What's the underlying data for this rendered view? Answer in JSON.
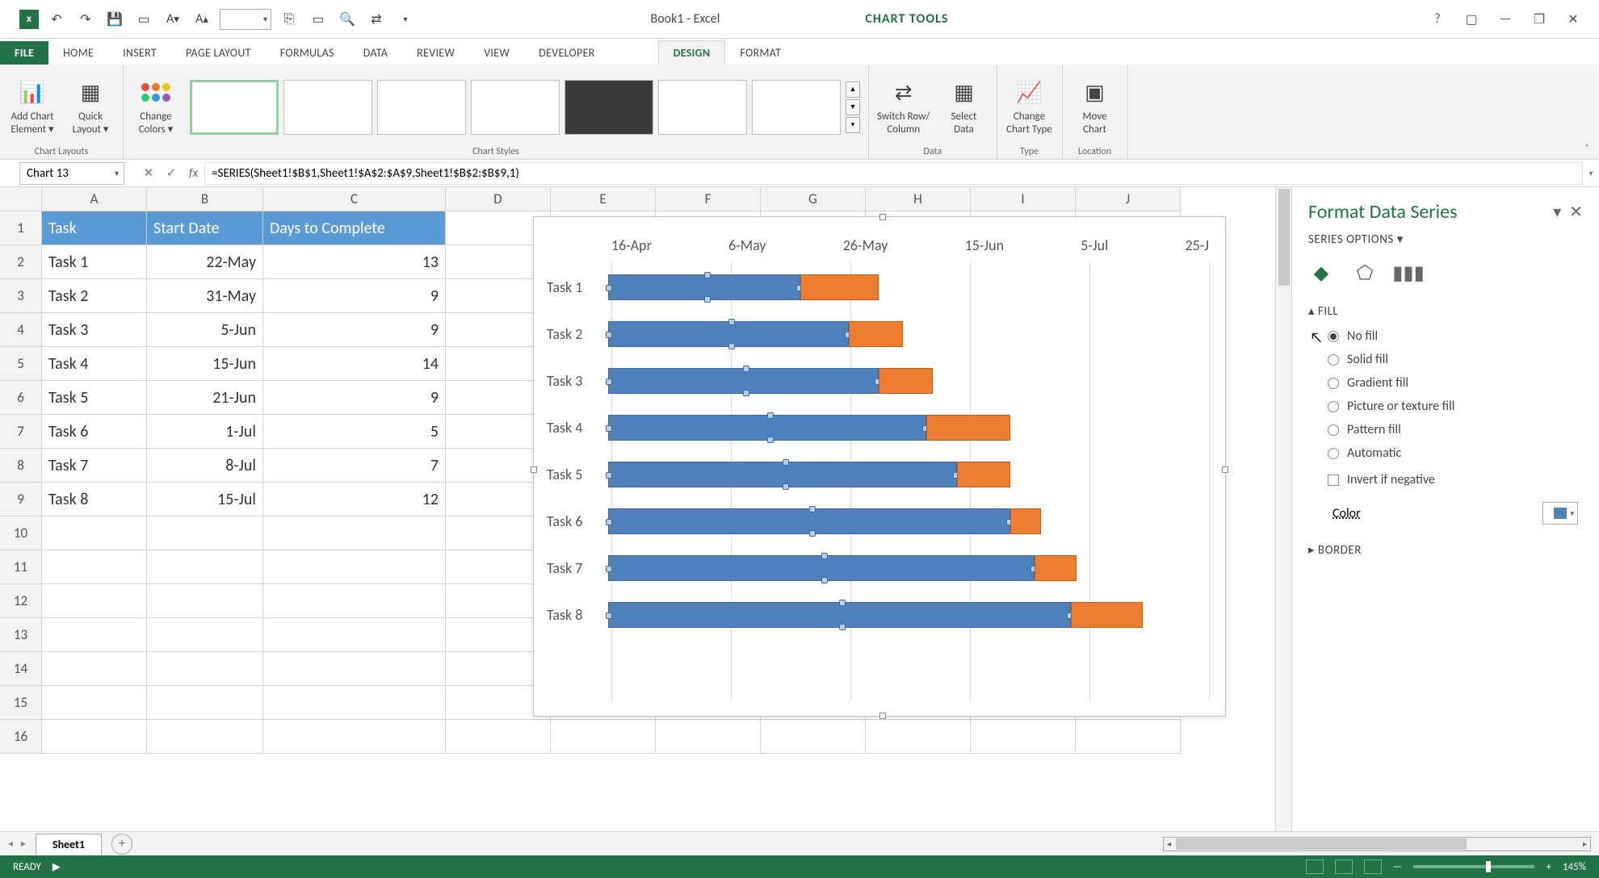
{
  "titlebar": {
    "app_title": "Book1 - Excel",
    "context_tools": "CHART TOOLS"
  },
  "ribbon": {
    "tabs": [
      "FILE",
      "HOME",
      "INSERT",
      "PAGE LAYOUT",
      "FORMULAS",
      "DATA",
      "REVIEW",
      "VIEW",
      "DEVELOPER"
    ],
    "context_tabs": [
      "DESIGN",
      "FORMAT"
    ],
    "active_tab": "DESIGN",
    "groups": {
      "chart_layouts": {
        "label": "Chart Layouts",
        "add_element": "Add Chart\nElement ▾",
        "quick_layout": "Quick\nLayout ▾"
      },
      "chart_styles": {
        "label": "Chart Styles",
        "change_colors": "Change\nColors ▾"
      },
      "data": {
        "label": "Data",
        "switch": "Switch Row/\nColumn",
        "select": "Select\nData"
      },
      "type": {
        "label": "Type",
        "change_type": "Change\nChart Type"
      },
      "location": {
        "label": "Location",
        "move": "Move\nChart"
      }
    }
  },
  "formula_bar": {
    "name_box": "Chart 13",
    "formula": "=SERIES(Sheet1!$B$1,Sheet1!$A$2:$A$9,Sheet1!$B$2:$B$9,1)"
  },
  "sheet": {
    "columns": [
      "A",
      "B",
      "C",
      "D",
      "E",
      "F",
      "G",
      "H",
      "I",
      "J"
    ],
    "headers": {
      "A": "Task",
      "B": "Start Date",
      "C": "Days to Complete"
    },
    "rows": [
      {
        "task": "Task 1",
        "start": "22-May",
        "days": "13"
      },
      {
        "task": "Task 2",
        "start": "31-May",
        "days": "9"
      },
      {
        "task": "Task 3",
        "start": "5-Jun",
        "days": "9"
      },
      {
        "task": "Task 4",
        "start": "15-Jun",
        "days": "14"
      },
      {
        "task": "Task 5",
        "start": "21-Jun",
        "days": "9"
      },
      {
        "task": "Task 6",
        "start": "1-Jul",
        "days": "5"
      },
      {
        "task": "Task 7",
        "start": "8-Jul",
        "days": "7"
      },
      {
        "task": "Task 8",
        "start": "15-Jul",
        "days": "12"
      }
    ],
    "visible_row_count": 16,
    "tab_name": "Sheet1"
  },
  "chart_data": {
    "type": "bar",
    "orientation": "horizontal-stacked",
    "title": "",
    "x_axis_ticks": [
      "16-Apr",
      "6-May",
      "26-May",
      "15-Jun",
      "5-Jul",
      "25-J"
    ],
    "categories": [
      "Task 1",
      "Task 2",
      "Task 3",
      "Task 4",
      "Task 5",
      "Task 6",
      "Task 7",
      "Task 8"
    ],
    "series": [
      {
        "name": "Start Date",
        "color": "#4f81bd",
        "values_pct": [
          32,
          40,
          45,
          53,
          58,
          67,
          71,
          77
        ]
      },
      {
        "name": "Days to Complete",
        "color": "#ed7d31",
        "values_pct": [
          13,
          9,
          9,
          14,
          9,
          5,
          7,
          12
        ]
      }
    ],
    "selected_series": 0
  },
  "format_pane": {
    "title": "Format Data Series",
    "dropdown": "SERIES OPTIONS ▾",
    "sections": {
      "fill": {
        "label": "FILL",
        "options": [
          "No fill",
          "Solid fill",
          "Gradient fill",
          "Picture or texture fill",
          "Pattern fill",
          "Automatic"
        ],
        "selected": "No fill",
        "invert_label": "Invert if negative",
        "color_label": "Color"
      },
      "border": {
        "label": "BORDER"
      }
    }
  },
  "statusbar": {
    "ready": "READY",
    "zoom": "145%"
  }
}
